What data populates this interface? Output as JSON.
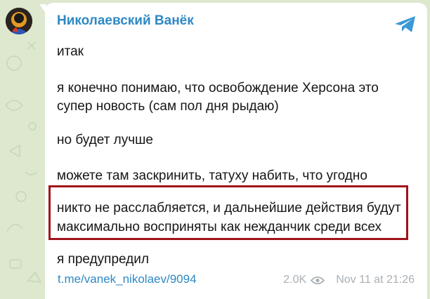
{
  "channel": {
    "name": "Николаевский Ванёк"
  },
  "message": {
    "lines": [
      "итак",
      "я конечно понимаю, что освобождение Херсона это",
      "супер новость (сам пол дня рыдаю)",
      "но будет лучше",
      "можете там заскринить, татуху набить, что угодно",
      "никто не расслабляется, и дальнейшие действия будут",
      "максимально восприняты как нежданчик среди всех",
      "я предупредил"
    ],
    "link": "t.me/vanek_nikolaev/9094"
  },
  "footer": {
    "views": "2.0K",
    "timestamp": "Nov 11 at 21:26"
  },
  "colors": {
    "accent": "#2e89c5",
    "highlight_border": "#a1121c",
    "wallpaper": "#dde8cf"
  },
  "icons": {
    "share": "telegram-share-icon",
    "views": "eye-icon"
  }
}
